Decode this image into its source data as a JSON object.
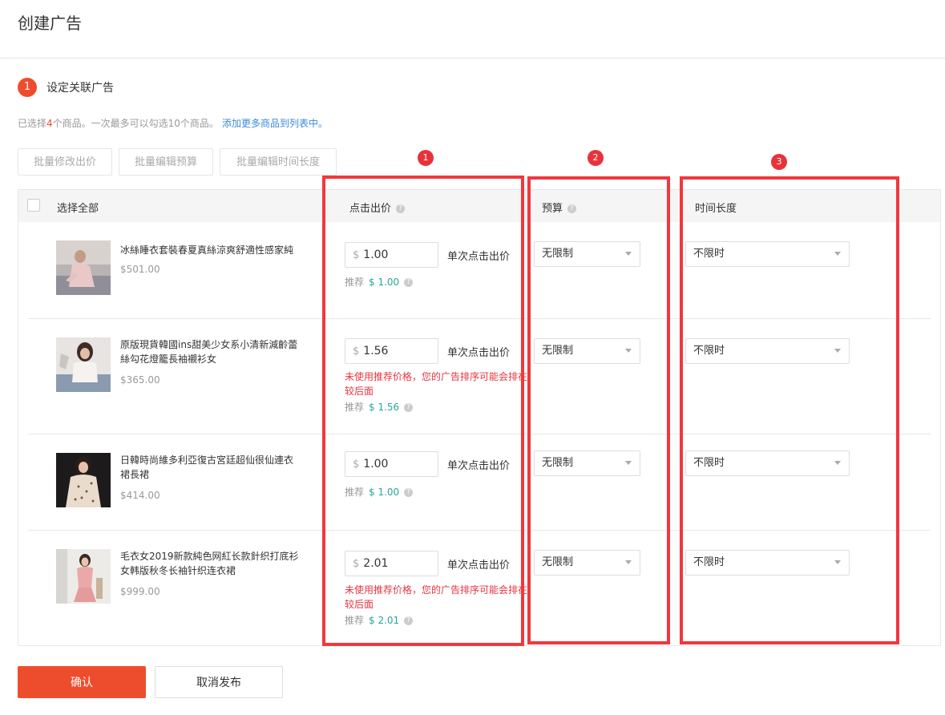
{
  "page": {
    "title": "创建广告"
  },
  "step": {
    "number": "1",
    "title": "设定关联广告"
  },
  "selection": {
    "prefix": "已选择",
    "count": "4",
    "suffix": "个商品。一次最多可以勾选10个商品。",
    "add_link": "添加更多商品到列表中。"
  },
  "bulk_actions": [
    "批量修改出价",
    "批量编辑预算",
    "批量编辑时间长度"
  ],
  "table": {
    "headers": {
      "select_all": "选择全部",
      "bid": "点击出价",
      "budget": "预算",
      "duration": "时间长度"
    },
    "rows": [
      {
        "name": "冰絲睡衣套裝春夏真絲涼爽舒適性感家純",
        "price": "$501.00",
        "bid_currency": "$",
        "bid": "1.00",
        "bid_unit": "单次点击出价",
        "warning": "",
        "rec_label": "推荐",
        "rec_value": "$ 1.00",
        "budget": "无限制",
        "duration": "不限时"
      },
      {
        "name": "原版現貨韓國ins甜美少女系小清新減齡蕾絲勾花燈籠長袖襯衫女",
        "price": "$365.00",
        "bid_currency": "$",
        "bid": "1.56",
        "bid_unit": "单次点击出价",
        "warning": "未使用推荐价格，您的广告排序可能会排在较后面",
        "rec_label": "推荐",
        "rec_value": "$ 1.56",
        "budget": "无限制",
        "duration": "不限时"
      },
      {
        "name": "日韓時尚維多利亞復古宮廷超仙很仙連衣裙長裙",
        "price": "$414.00",
        "bid_currency": "$",
        "bid": "1.00",
        "bid_unit": "单次点击出价",
        "warning": "",
        "rec_label": "推荐",
        "rec_value": "$ 1.00",
        "budget": "无限制",
        "duration": "不限时"
      },
      {
        "name": "毛衣女2019新款純色网紅长款針织打底衫女韩版秋冬长袖针织连衣裙",
        "price": "$999.00",
        "bid_currency": "$",
        "bid": "2.01",
        "bid_unit": "单次点击出价",
        "warning": "未使用推荐价格，您的广告排序可能会排在较后面",
        "rec_label": "推荐",
        "rec_value": "$ 2.01",
        "budget": "无限制",
        "duration": "不限时"
      }
    ]
  },
  "annotations": [
    "1",
    "2",
    "3"
  ],
  "footer": {
    "confirm": "确认",
    "cancel": "取消发布"
  },
  "colors": {
    "accent": "#ee4d2d",
    "annotation_red": "#f2373d",
    "recommend_green": "#26a69a",
    "warning_red": "#e5363f",
    "link_blue": "#3b8ad9"
  }
}
